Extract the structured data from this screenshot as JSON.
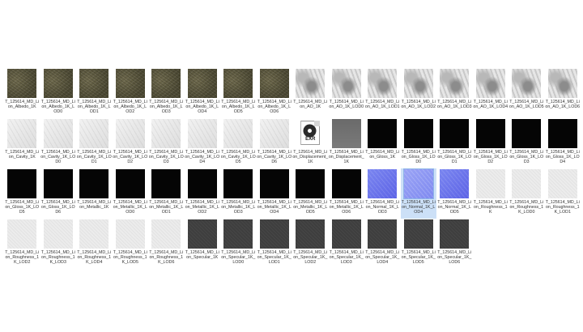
{
  "exr_label": "EXR",
  "items": [
    {
      "label": "T_125614_MD_Lion_Albedo_1K",
      "tex": "albedo"
    },
    {
      "label": "T_125614_MD_Lion_Albedo_1K_LOD0",
      "tex": "albedo"
    },
    {
      "label": "T_125614_MD_Lion_Albedo_1K_LOD1",
      "tex": "albedo"
    },
    {
      "label": "T_125614_MD_Lion_Albedo_1K_LOD2",
      "tex": "albedo"
    },
    {
      "label": "T_125614_MD_Lion_Albedo_1K_LOD3",
      "tex": "albedo"
    },
    {
      "label": "T_125614_MD_Lion_Albedo_1K_LOD4",
      "tex": "albedo"
    },
    {
      "label": "T_125614_MD_Lion_Albedo_1K_LOD5",
      "tex": "albedo"
    },
    {
      "label": "T_125614_MD_Lion_Albedo_1K_LOD6",
      "tex": "albedo"
    },
    {
      "label": "T_125614_MD_Lion_AO_1K",
      "tex": "ao"
    },
    {
      "label": "T_125614_MD_Lion_AO_1K_LOD0",
      "tex": "ao"
    },
    {
      "label": "T_125614_MD_Lion_AO_1K_LOD1",
      "tex": "ao"
    },
    {
      "label": "T_125614_MD_Lion_AO_1K_LOD2",
      "tex": "ao"
    },
    {
      "label": "T_125614_MD_Lion_AO_1K_LOD3",
      "tex": "ao"
    },
    {
      "label": "T_125614_MD_Lion_AO_1K_LOD4",
      "tex": "ao"
    },
    {
      "label": "T_125614_MD_Lion_AO_1K_LOD5",
      "tex": "ao"
    },
    {
      "label": "T_125614_MD_Lion_AO_1K_LOD6",
      "tex": "ao"
    },
    {
      "label": "T_125614_MD_Lion_Cavity_1K",
      "tex": "cavity"
    },
    {
      "label": "T_125614_MD_Lion_Cavity_1K_LOD0",
      "tex": "cavity"
    },
    {
      "label": "T_125614_MD_Lion_Cavity_1K_LOD1",
      "tex": "cavity"
    },
    {
      "label": "T_125614_MD_Lion_Cavity_1K_LOD2",
      "tex": "cavity"
    },
    {
      "label": "T_125614_MD_Lion_Cavity_1K_LOD3",
      "tex": "cavity"
    },
    {
      "label": "T_125614_MD_Lion_Cavity_1K_LOD4",
      "tex": "cavity"
    },
    {
      "label": "T_125614_MD_Lion_Cavity_1K_LOD5",
      "tex": "cavity"
    },
    {
      "label": "T_125614_MD_Lion_Cavity_1K_LOD6",
      "tex": "cavity"
    },
    {
      "label": "T_125614_MD_Lion_Displacement_1K",
      "tex": "exr"
    },
    {
      "label": "T_125614_MD_Lion_Displacement_1K",
      "tex": "disp"
    },
    {
      "label": "T_125614_MD_Lion_Gloss_1K",
      "tex": "black"
    },
    {
      "label": "T_125614_MD_Lion_Gloss_1K_LOD0",
      "tex": "black"
    },
    {
      "label": "T_125614_MD_Lion_Gloss_1K_LOD1",
      "tex": "black"
    },
    {
      "label": "T_125614_MD_Lion_Gloss_1K_LOD2",
      "tex": "black"
    },
    {
      "label": "T_125614_MD_Lion_Gloss_1K_LOD3",
      "tex": "black"
    },
    {
      "label": "T_125614_MD_Lion_Gloss_1K_LOD4",
      "tex": "black"
    },
    {
      "label": "T_125614_MD_Lion_Gloss_1K_LOD5",
      "tex": "black"
    },
    {
      "label": "T_125614_MD_Lion_Gloss_1K_LOD6",
      "tex": "black"
    },
    {
      "label": "T_125614_MD_Lion_Metallic_1K",
      "tex": "black"
    },
    {
      "label": "T_125614_MD_Lion_Metallic_1K_LOD0",
      "tex": "black"
    },
    {
      "label": "T_125614_MD_Lion_Metallic_1K_LOD1",
      "tex": "black"
    },
    {
      "label": "T_125614_MD_Lion_Metallic_1K_LOD2",
      "tex": "black"
    },
    {
      "label": "T_125614_MD_Lion_Metallic_1K_LOD3",
      "tex": "black"
    },
    {
      "label": "T_125614_MD_Lion_Metallic_1K_LOD4",
      "tex": "black"
    },
    {
      "label": "T_125614_MD_Lion_Metallic_1K_LOD5",
      "tex": "black"
    },
    {
      "label": "T_125614_MD_Lion_Metallic_1K_LOD6",
      "tex": "black"
    },
    {
      "label": "T_125614_MD_Lion_Normal_1K_LOD3",
      "tex": "normal"
    },
    {
      "label": "T_125614_MD_Lion_Normal_1K_LOD4",
      "tex": "normal-sel",
      "selected": true
    },
    {
      "label": "T_125614_MD_Lion_Normal_1K_LOD5",
      "tex": "normal"
    },
    {
      "label": "T_125614_MD_Lion_Roughness_1K",
      "tex": "rough"
    },
    {
      "label": "T_125614_MD_Lion_Roughness_1K_LOD0",
      "tex": "rough"
    },
    {
      "label": "T_125614_MD_Lion_Roughness_1K_LOD1",
      "tex": "rough"
    },
    {
      "label": "T_125614_MD_Lion_Roughness_1K_LOD2",
      "tex": "rough"
    },
    {
      "label": "T_125614_MD_Lion_Roughness_1K_LOD3",
      "tex": "rough"
    },
    {
      "label": "T_125614_MD_Lion_Roughness_1K_LOD4",
      "tex": "rough"
    },
    {
      "label": "T_125614_MD_Lion_Roughness_1K_LOD5",
      "tex": "rough"
    },
    {
      "label": "T_125614_MD_Lion_Roughness_1K_LOD6",
      "tex": "rough"
    },
    {
      "label": "T_125614_MD_Lion_Specular_1K",
      "tex": "spec"
    },
    {
      "label": "T_125614_MD_Lion_Specular_1K_LOD0",
      "tex": "spec"
    },
    {
      "label": "T_125614_MD_Lion_Specular_1K_LOD1",
      "tex": "spec"
    },
    {
      "label": "T_125614_MD_Lion_Specular_1K_LOD2",
      "tex": "spec"
    },
    {
      "label": "T_125614_MD_Lion_Specular_1K_LOD3",
      "tex": "spec"
    },
    {
      "label": "T_125614_MD_Lion_Specular_1K_LOD4",
      "tex": "spec"
    },
    {
      "label": "T_125614_MD_Lion_Specular_1K_LOD5",
      "tex": "spec"
    },
    {
      "label": "T_125614_MD_Lion_Specular_1K_LOD6",
      "tex": "spec"
    }
  ]
}
